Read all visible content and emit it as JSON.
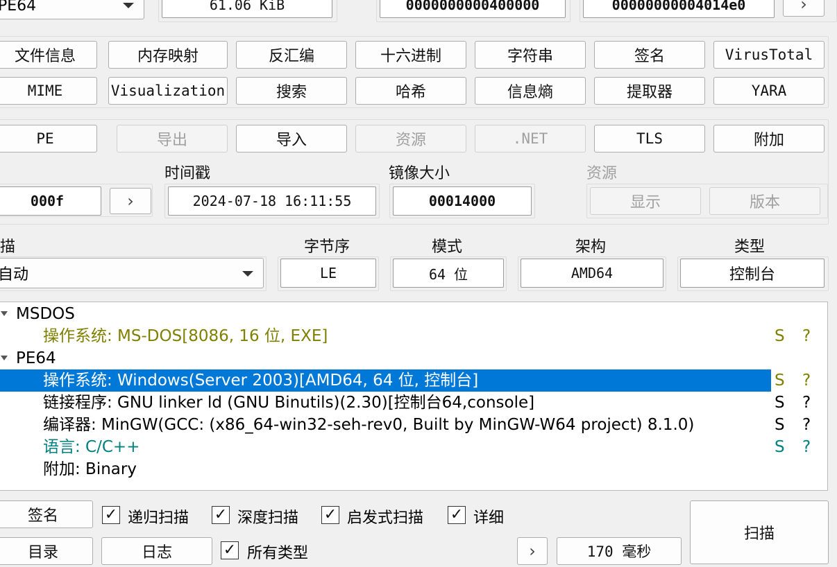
{
  "top": {
    "type_value": "PE64",
    "size": "61.06 KiB",
    "offset": "0000000000400000",
    "entry": "00000000004014e0"
  },
  "tools": {
    "row1": [
      "文件信息",
      "内存映射",
      "反汇编",
      "十六进制",
      "字符串",
      "签名",
      "VirusTotal"
    ],
    "row2": [
      "MIME",
      "Visualization",
      "搜索",
      "哈希",
      "信息熵",
      "提取器",
      "YARA"
    ]
  },
  "pe_tabs": [
    "PE",
    "导出",
    "导入",
    "资源",
    ".NET",
    "TLS",
    "附加"
  ],
  "info": {
    "timestamp_label": "时间戳",
    "timestamp": "2024-07-18 16:11:55",
    "image_size_label": "镜像大小",
    "image_size": "00014000",
    "partial_field": "000f",
    "resources_label": "资源",
    "show_button": "显示",
    "version_button": "版本"
  },
  "scan_params": {
    "scan_label": "描",
    "scan_mode": "自动",
    "endian_label": "字节序",
    "endian": "LE",
    "mode_label": "模式",
    "mode": "64 位",
    "arch_label": "架构",
    "arch": "AMD64",
    "type_label": "类型",
    "type": "控制台"
  },
  "results": {
    "group1": "MSDOS",
    "g1_item": "操作系统: MS-DOS[8086, 16 位, EXE]",
    "group2": "PE64",
    "g2_items": [
      "操作系统: Windows(Server 2003)[AMD64, 64 位, 控制台]",
      "链接程序: GNU linker ld (GNU Binutils)(2.30)[控制台64,console]",
      "编译器: MinGW(GCC: (x86_64-win32-seh-rev0, Built by MinGW-W64 project) 8.1.0)",
      "语言: C/C++",
      "附加: Binary"
    ],
    "s": "S",
    "q": "?"
  },
  "bottom": {
    "signatures_button": "签名",
    "directory_button": "目录",
    "log_button": "日志",
    "recursive": "递归扫描",
    "deep": "深度扫描",
    "heuristic": "启发式扫描",
    "verbose": "详细",
    "all_types": "所有类型",
    "elapsed": "170 毫秒",
    "scan_button": "扫描",
    "check_mark": "✓"
  },
  "colors": {
    "selection": "#0078d7",
    "olive": "#808000",
    "teal": "#008080"
  }
}
